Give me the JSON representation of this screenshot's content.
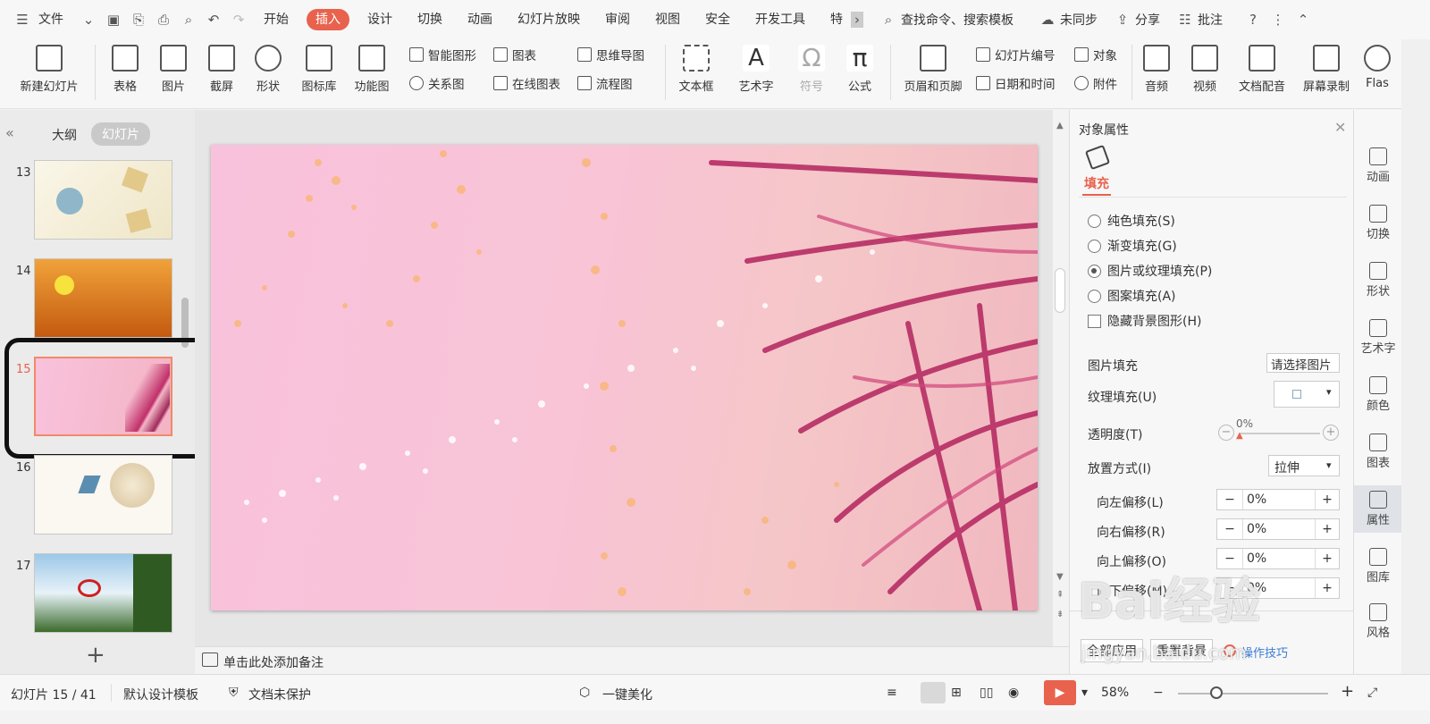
{
  "menubar": {
    "file": "文件",
    "tabs": [
      "开始",
      "插入",
      "设计",
      "切换",
      "动画",
      "幻灯片放映",
      "审阅",
      "视图",
      "安全",
      "开发工具",
      "特"
    ],
    "active_tab": "插入",
    "search": "查找命令、搜索模板",
    "sync": "未同步",
    "share": "分享",
    "comment": "批注"
  },
  "ribbon": {
    "new_slide": "新建幻灯片",
    "table": "表格",
    "picture": "图片",
    "screenshot": "截屏",
    "shape": "形状",
    "icon_lib": "图标库",
    "func_chart": "功能图",
    "smart_shape": "智能图形",
    "chart": "图表",
    "relation": "关系图",
    "online_chart": "在线图表",
    "mindmap": "思维导图",
    "flowchart": "流程图",
    "textbox": "文本框",
    "wordart": "艺术字",
    "symbol": "符号",
    "formula": "公式",
    "header_footer": "页眉和页脚",
    "slide_number": "幻灯片编号",
    "object": "对象",
    "datetime": "日期和时间",
    "attachment": "附件",
    "audio": "音频",
    "video": "视频",
    "narration": "文档配音",
    "screen_record": "屏幕录制",
    "flash": "Flas"
  },
  "leftpanel": {
    "tab_outline": "大纲",
    "tab_slides": "幻灯片",
    "slides": [
      "13",
      "14",
      "15",
      "16",
      "17"
    ],
    "add": "+"
  },
  "notes": "单击此处添加备注",
  "properties": {
    "title": "对象属性",
    "fill_tab": "填充",
    "options": [
      "纯色填充(S)",
      "渐变填充(G)",
      "图片或纹理填充(P)",
      "图案填充(A)"
    ],
    "hide_bg": "隐藏背景图形(H)",
    "picture_fill": "图片填充",
    "picture_fill_value": "请选择图片",
    "texture_fill": "纹理填充(U)",
    "transparency": "透明度(T)",
    "transparency_value": "0%",
    "placement": "放置方式(I)",
    "placement_value": "拉伸",
    "offsets": [
      {
        "label": "向左偏移(L)",
        "value": "0%"
      },
      {
        "label": "向右偏移(R)",
        "value": "0%"
      },
      {
        "label": "向上偏移(O)",
        "value": "0%"
      },
      {
        "label": "向下偏移(M)",
        "value": "0%"
      }
    ],
    "apply_all": "全部应用",
    "reset_bg": "重置背景",
    "tips": "操作技巧"
  },
  "rsidebar": [
    "动画",
    "切换",
    "形状",
    "艺术字",
    "颜色",
    "图表",
    "属性",
    "图库",
    "风格"
  ],
  "status": {
    "slide_counter": "幻灯片 15 / 41",
    "template": "默认设计模板",
    "protect": "文档未保护",
    "beautify": "一键美化",
    "zoom": "58%"
  },
  "watermark": {
    "brand": "Bai经验",
    "url": "jingyan.baidu.com"
  },
  "colors": {
    "accent": "#e8624d",
    "selected_border": "#f08a6a"
  }
}
